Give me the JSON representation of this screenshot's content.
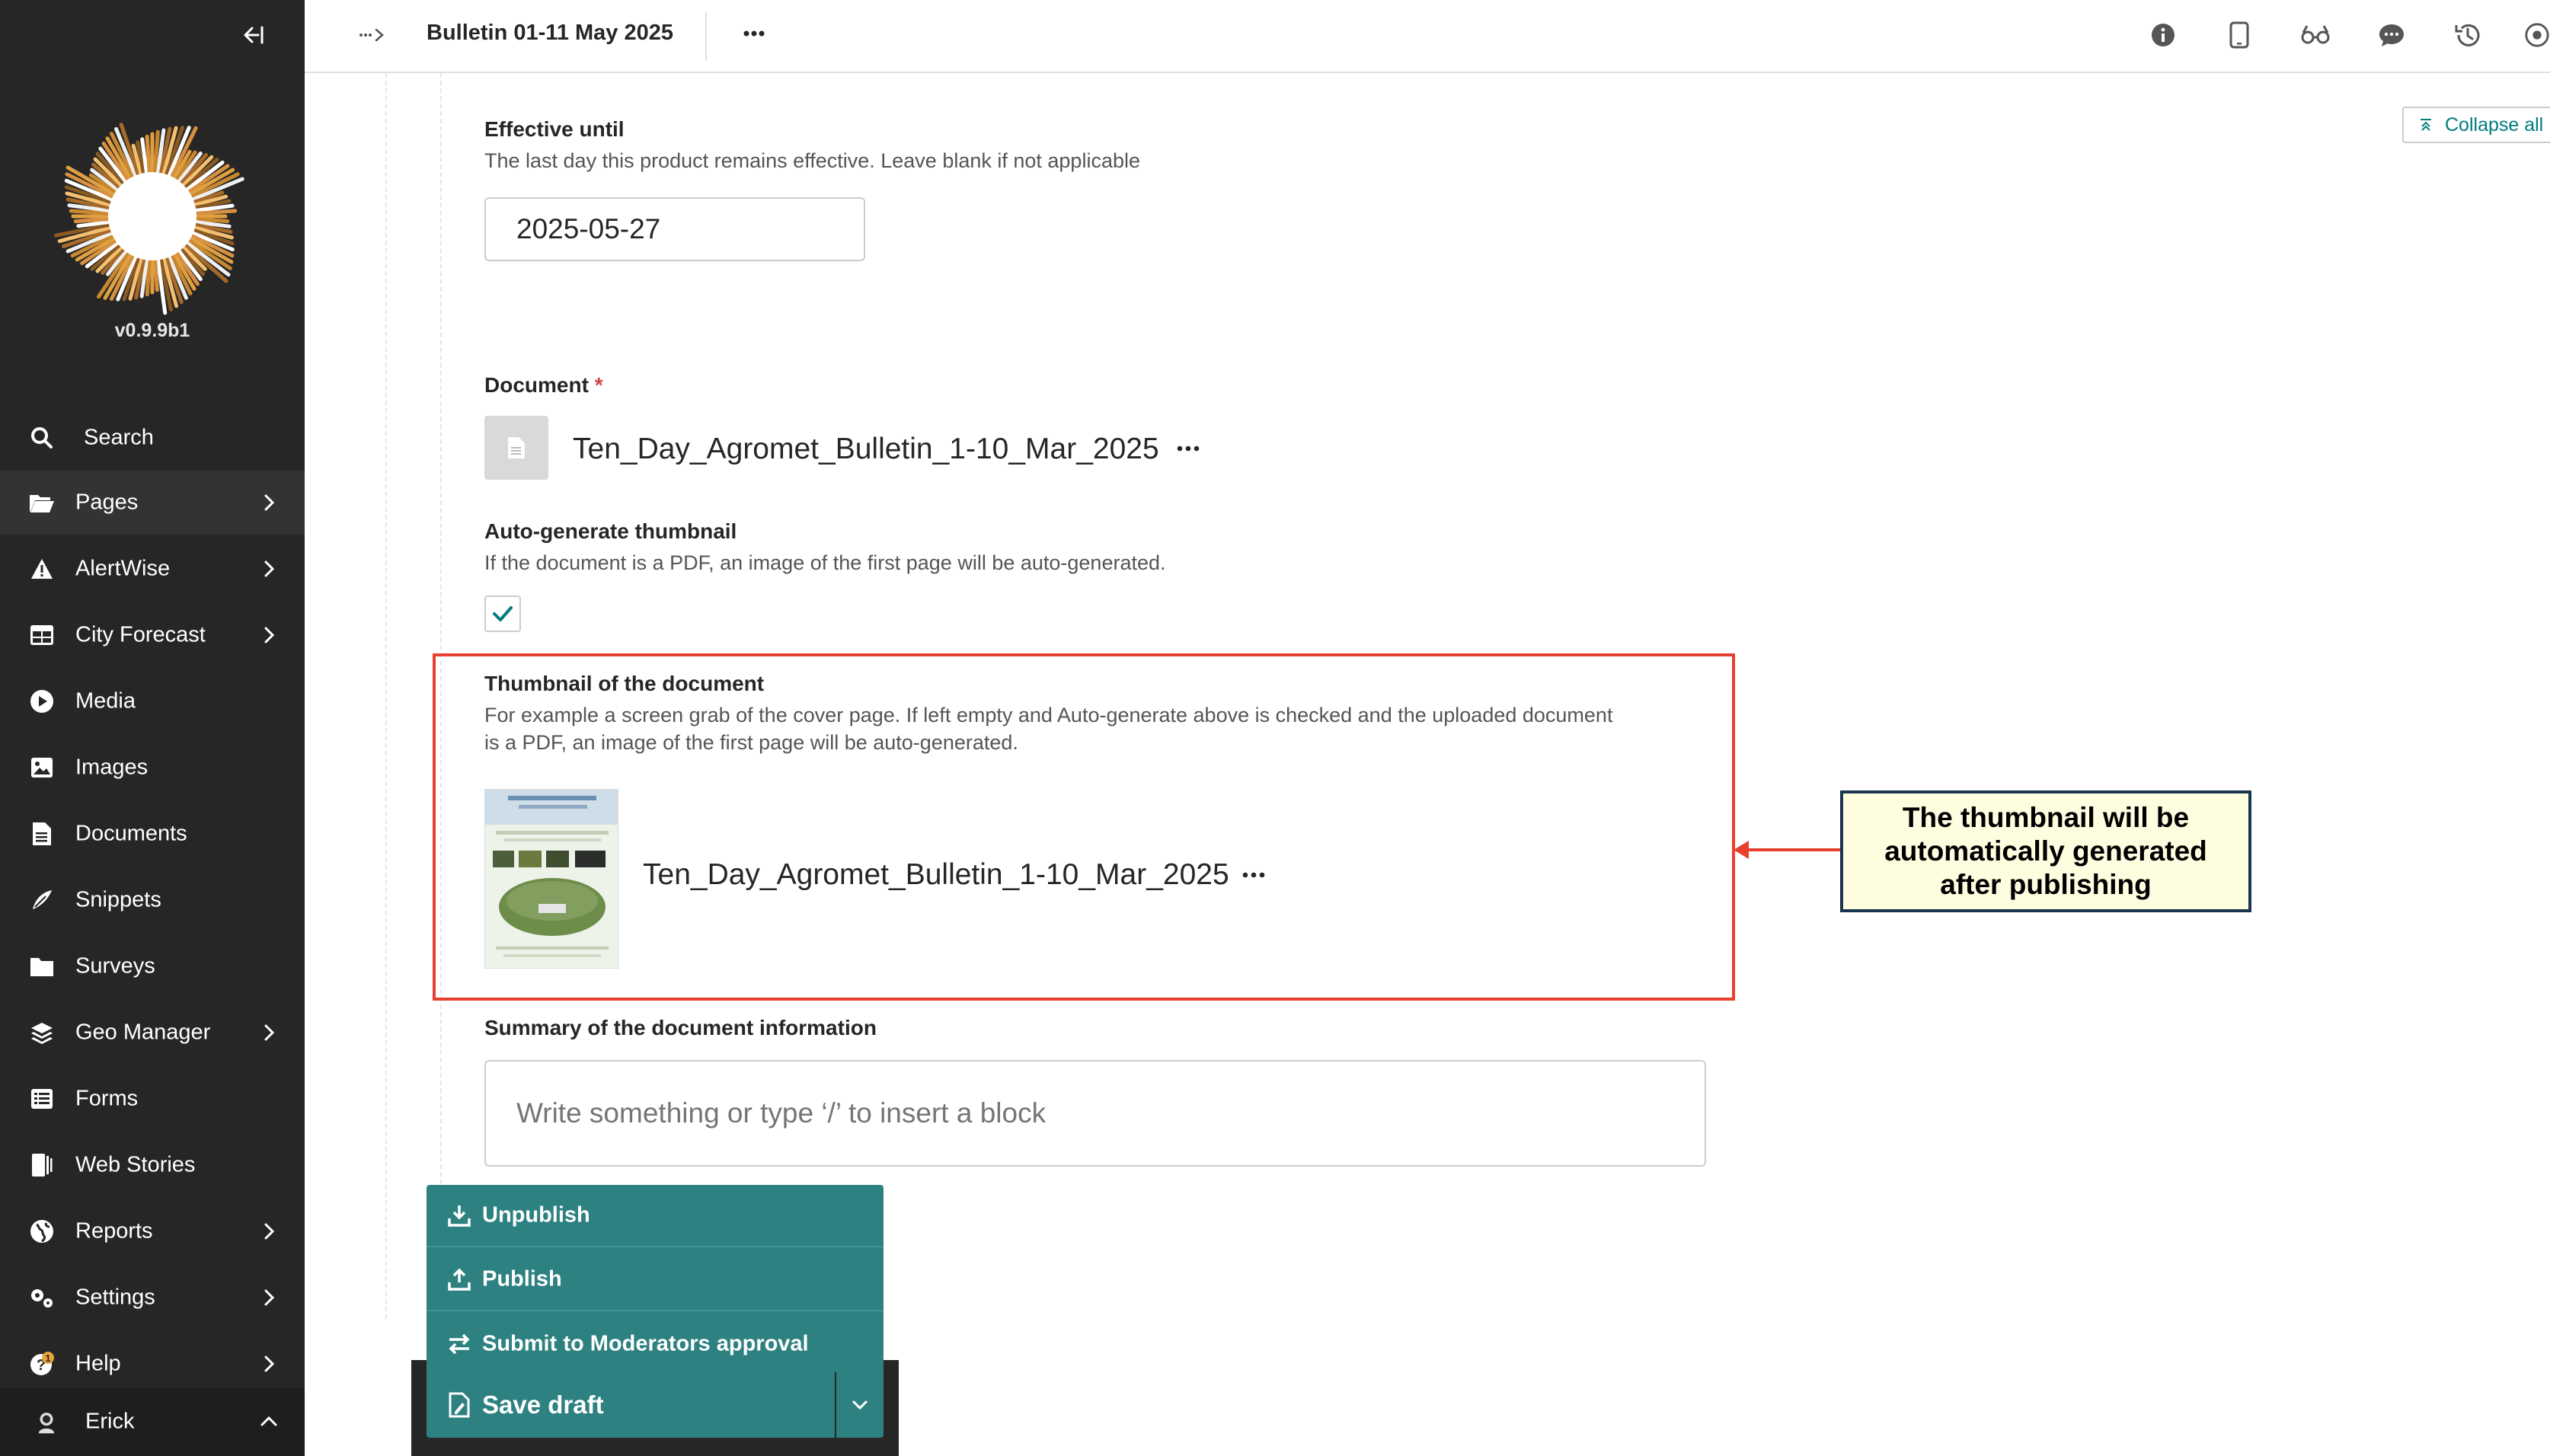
{
  "sidebar": {
    "version": "v0.9.9b1",
    "items": [
      {
        "label": "Search",
        "icon": "search-icon"
      },
      {
        "label": "Pages",
        "icon": "folder-open-icon"
      },
      {
        "label": "AlertWise",
        "icon": "warning-icon"
      },
      {
        "label": "City Forecast",
        "icon": "table-icon"
      },
      {
        "label": "Media",
        "icon": "play-icon"
      },
      {
        "label": "Images",
        "icon": "image-icon"
      },
      {
        "label": "Documents",
        "icon": "doc-icon"
      },
      {
        "label": "Snippets",
        "icon": "snippet-icon"
      },
      {
        "label": "Surveys",
        "icon": "folder-icon"
      },
      {
        "label": "Geo Manager",
        "icon": "layers-icon"
      },
      {
        "label": "Forms",
        "icon": "form-icon"
      },
      {
        "label": "Web Stories",
        "icon": "stories-icon"
      },
      {
        "label": "Reports",
        "icon": "globe-icon"
      },
      {
        "label": "Settings",
        "icon": "cogs-icon"
      },
      {
        "label": "Help",
        "icon": "help-icon",
        "badge": "1"
      }
    ],
    "user": "Erick"
  },
  "header": {
    "title": "Bulletin 01-11 May 2025"
  },
  "main": {
    "collapse_all": "Collapse all",
    "effective_until": {
      "label": "Effective until",
      "help": "The last day this product remains effective. Leave blank if not applicable",
      "value": "2025-05-27"
    },
    "document": {
      "label": "Document",
      "required_mark": "*",
      "file_name": "Ten_Day_Agromet_Bulletin_1-10_Mar_2025"
    },
    "auto_thumbnail": {
      "label": "Auto-generate thumbnail",
      "help": "If the document is a PDF, an image of the first page will be auto-generated.",
      "checked": true
    },
    "thumbnail": {
      "label": "Thumbnail of the document",
      "help_line1": "For example a screen grab of the cover page. If left empty and Auto-generate above is checked and the uploaded document",
      "help_line2": "is a PDF, an image of the first page will be auto-generated.",
      "file_name": "Ten_Day_Agromet_Bulletin_1-10_Mar_2025"
    },
    "annotation": "The thumbnail will be automatically generated after publishing",
    "summary": {
      "label": "Summary of the document information",
      "placeholder": "Write something or type ‘/’ to insert a block"
    }
  },
  "actions": {
    "unpublish": "Unpublish",
    "publish": "Publish",
    "submit": "Submit to Moderators approval",
    "save_draft": "Save draft"
  },
  "colors": {
    "sidebar_bg": "#262626",
    "accent_teal": "#2e8181",
    "highlight_red": "#e8402f",
    "annotation_bg": "#fffde0"
  }
}
